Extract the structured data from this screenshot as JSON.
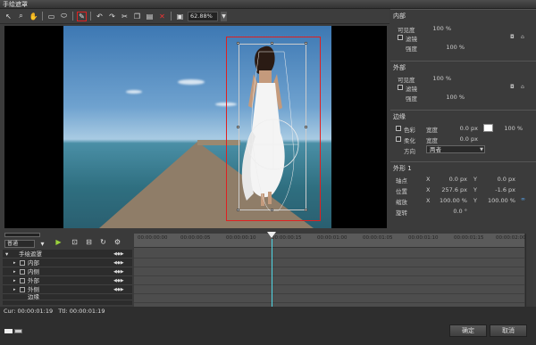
{
  "window": {
    "title": "手绘遮罩"
  },
  "toolbar": {
    "zoom": "62.88%"
  },
  "inner": {
    "title": "内部",
    "opacity_label": "可见度",
    "opacity": "100 %",
    "filter_label": "滤镜",
    "filter_value": "100 %",
    "strength_label": "强度"
  },
  "outer": {
    "title": "外部",
    "opacity_label": "可见度",
    "opacity": "100 %",
    "filter_label": "滤镜",
    "filter_value": "100 %",
    "strength_label": "强度"
  },
  "edge": {
    "title": "边缘",
    "color_label": "色彩",
    "width_label": "宽度",
    "width1": "0.0 px",
    "color_pct": "100 %",
    "soften_label": "柔化",
    "width2": "0.0 px",
    "direction_label": "方向",
    "direction": "两者"
  },
  "shape": {
    "title": "外形 1",
    "axis_label": "轴点",
    "pos_label": "位置",
    "scale_label": "缩放",
    "rotate_label": "旋转",
    "x": "X",
    "y": "Y",
    "axis_x": "0.0 px",
    "axis_y": "0.0 px",
    "pos_x": "257.6 px",
    "pos_y": "-1.6 px",
    "scale_x": "100.00 %",
    "scale_y": "100.00 %",
    "rotate": "0.0 °"
  },
  "timeline": {
    "mode": "普通",
    "ruler": [
      "00:00:00:00",
      "00:00:00:05",
      "00:00:00:10",
      "00:00:00:15",
      "00:00:01:00",
      "00:00:01:05",
      "00:00:01:10",
      "00:00:01:15",
      "00:00:02:00"
    ],
    "tracks": [
      "手绘遮罩",
      "内部",
      "内侧",
      "外部",
      "外侧",
      "边缘"
    ],
    "cur": "Cur: 00:00:01:19",
    "ttl": "Ttl: 00:00:01:19"
  },
  "footer": {
    "ok": "确定",
    "cancel": "取消"
  },
  "colors": {
    "accent_red": "#e02020",
    "playline": "#4fd6e4"
  }
}
